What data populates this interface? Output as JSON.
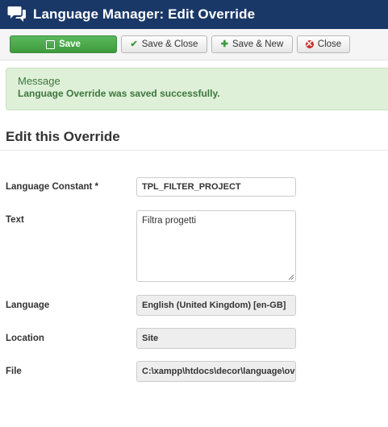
{
  "header": {
    "title": "Language Manager: Edit Override"
  },
  "toolbar": {
    "save_label": "Save",
    "save_close_label": "Save & Close",
    "save_new_label": "Save & New",
    "close_label": "Close"
  },
  "alert": {
    "heading": "Message",
    "message": "Language Override was saved successfully."
  },
  "form": {
    "section_title": "Edit this Override",
    "constant": {
      "label": "Language Constant *",
      "value": "TPL_FILTER_PROJECT"
    },
    "text": {
      "label": "Text",
      "value": "Filtra progetti"
    },
    "language": {
      "label": "Language",
      "value": "English (United Kingdom) [en-GB]"
    },
    "location": {
      "label": "Location",
      "value": "Site"
    },
    "file": {
      "label": "File",
      "value": "C:\\xampp\\htdocs\\decor\\language\\overrides\\en-GB.override.ini"
    }
  },
  "colors": {
    "header_bg": "#1a3867",
    "save_button": "#46a546",
    "alert_bg": "#dff0d8",
    "alert_text": "#3c763d"
  }
}
